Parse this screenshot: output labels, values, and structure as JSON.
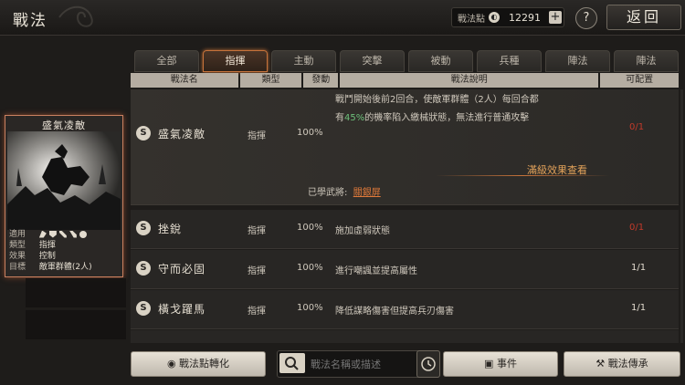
{
  "header": {
    "title": "戰法",
    "points_label": "戰法點",
    "points_value": "12291",
    "help_label": "?",
    "back_label": "返回"
  },
  "tabs": [
    "全部",
    "指揮",
    "主動",
    "突擊",
    "被動",
    "兵種",
    "陣法",
    "陣法"
  ],
  "active_tab": "指揮",
  "columns": [
    "戰法名",
    "類型",
    "發動",
    "戰法說明",
    "可配置"
  ],
  "selected_card": {
    "title": "盛氣凌敵",
    "info": [
      {
        "key": "適用",
        "value": ""
      },
      {
        "key": "類型",
        "value": "指揮"
      },
      {
        "key": "效果",
        "value": "控制"
      },
      {
        "key": "目標",
        "value": "敵軍群體(2人)"
      }
    ]
  },
  "rows": [
    {
      "badge": "S",
      "name": "盛氣凌敵",
      "type": "指揮",
      "rate": "100%",
      "desc_line1": "戰鬥開始後前2回合，使敵軍群體（2人）每回合都",
      "desc_line2_pre": "有",
      "desc_line2_pct": "45%",
      "desc_line2_post": "的機率陷入繳械狀態，無法進行普通攻擊",
      "link": "滿級效果查看",
      "learned_label": "已學武將:",
      "learned_name": "關銀屏",
      "config": "0/1"
    },
    {
      "badge": "S",
      "name": "挫銳",
      "type": "指揮",
      "rate": "100%",
      "desc": "施加虛弱狀態",
      "config": "0/1"
    },
    {
      "badge": "S",
      "name": "守而必固",
      "type": "指揮",
      "rate": "100%",
      "desc": "進行嘲諷並提高屬性",
      "config": "1/1"
    },
    {
      "badge": "S",
      "name": "橫戈躍馬",
      "type": "指揮",
      "rate": "100%",
      "desc": "降低謀略傷害但提高兵刃傷害",
      "config": "1/1"
    }
  ],
  "bottom": {
    "convert_label": "戰法點轉化",
    "search_placeholder": "戰法名稱或描述",
    "event_label": "事件",
    "inherit_label": "戰法傳承"
  }
}
